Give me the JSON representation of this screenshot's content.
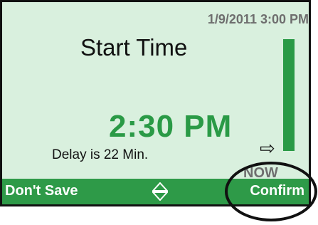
{
  "status": {
    "datetime": "1/9/2011 3:00 PM"
  },
  "main": {
    "title": "Start Time",
    "time_value": "2:30 PM",
    "delay_text": "Delay is 22 Min.",
    "now_label": "NOW"
  },
  "scale": {
    "fill_fraction": 1.0,
    "marker_icon": "right-arrow-icon"
  },
  "softkeys": {
    "left_label": "Don't Save",
    "center_icon": "up-down-arrows-icon",
    "right_label": "Confirm"
  },
  "colors": {
    "screen_background": "#d9f0de",
    "accent_green": "#2a9a46",
    "softkey_bar": "#2e9a48",
    "gray_text": "#6e6e6e"
  }
}
